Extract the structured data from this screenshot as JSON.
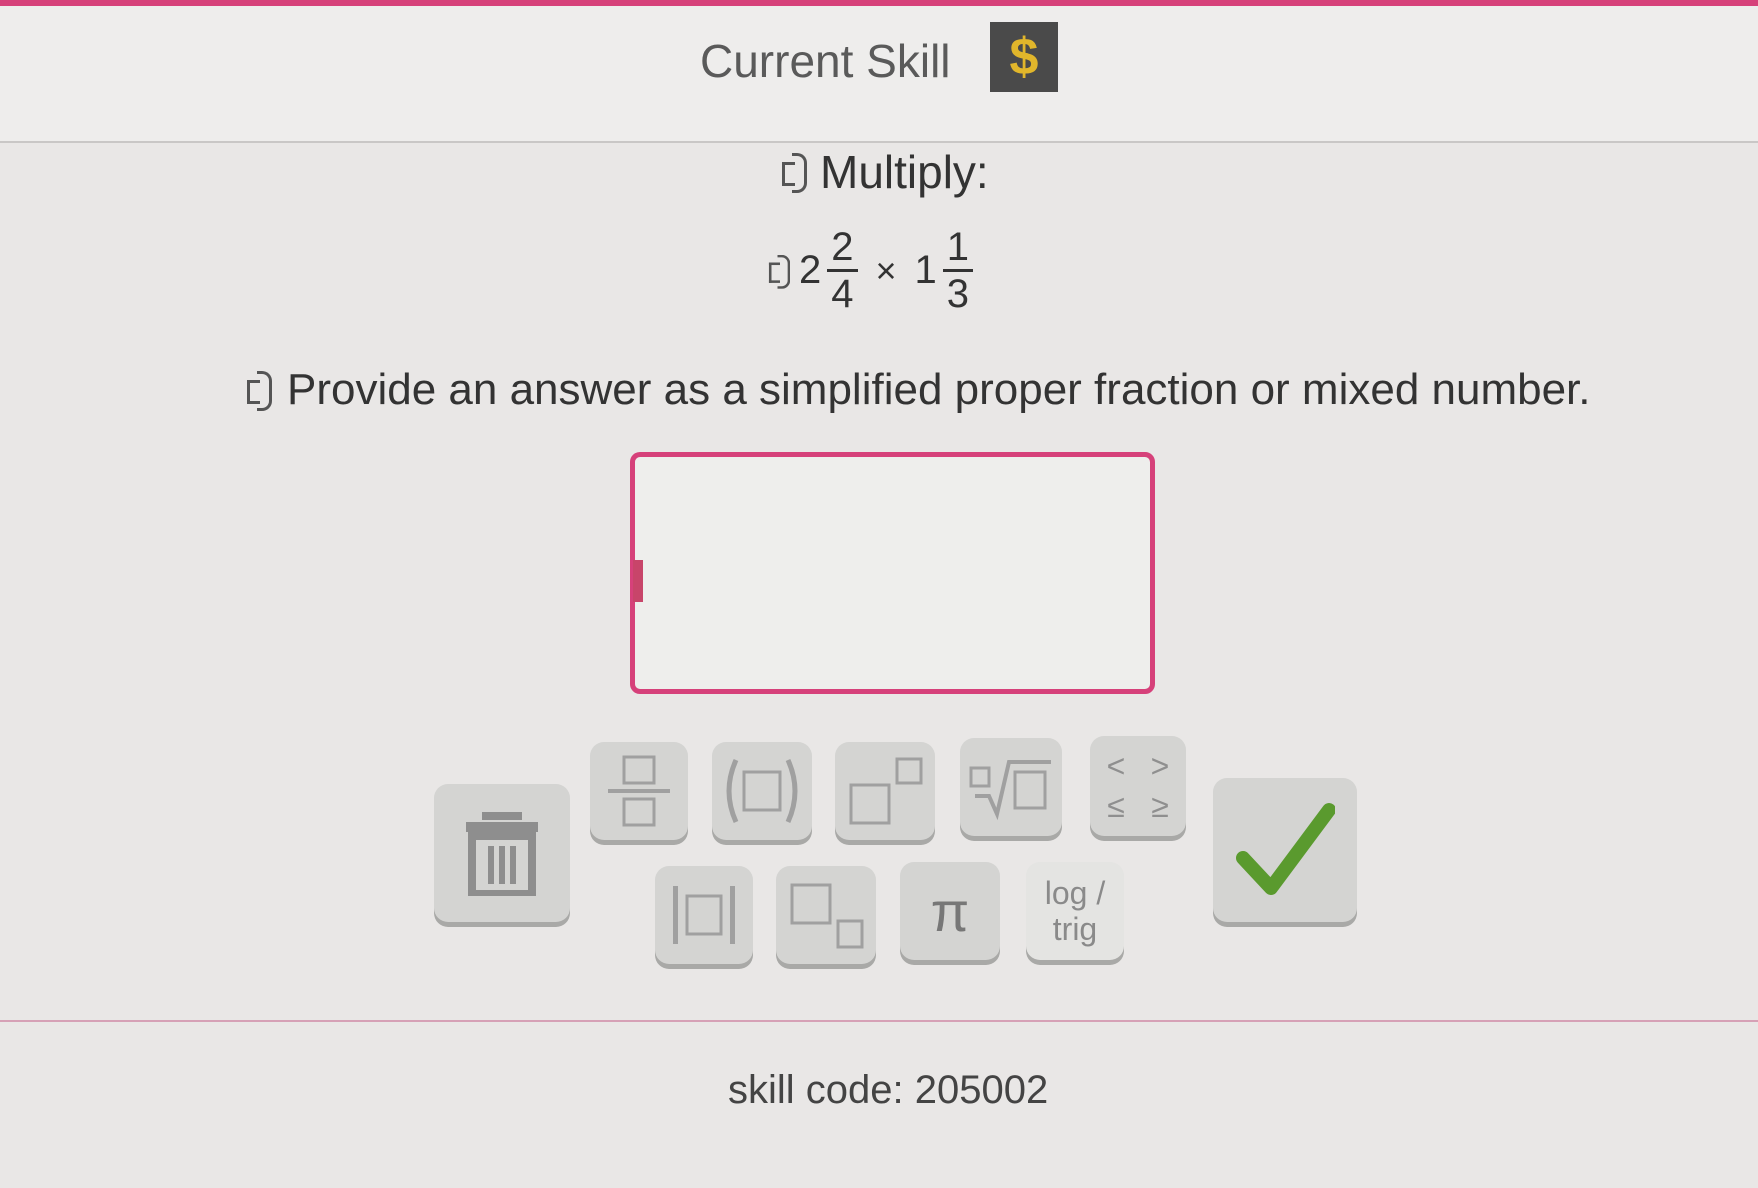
{
  "header": {
    "title": "Current Skill",
    "badge": "$"
  },
  "question": {
    "prompt": "Multiply:",
    "expression": {
      "left": {
        "whole": "2",
        "numerator": "2",
        "denominator": "4"
      },
      "operator": "×",
      "right": {
        "whole": "1",
        "numerator": "1",
        "denominator": "3"
      }
    },
    "instruction": "Provide an answer as a simplified proper fraction or mixed number."
  },
  "answer": {
    "value": ""
  },
  "keypad": {
    "comparison": {
      "lt": "<",
      "gt": ">",
      "le": "≤",
      "ge": "≥"
    },
    "pi": "π",
    "log_trig": {
      "line1": "log /",
      "line2": "trig"
    }
  },
  "footer": {
    "skill_code": "skill code: 205002"
  },
  "colors": {
    "accent": "#d6417a",
    "check": "#5a9a2e",
    "badge_bg": "#4a4a4a",
    "badge_fg": "#e1b62b"
  },
  "icons": [
    "speaker-icon",
    "trash-icon",
    "fraction-icon",
    "parentheses-icon",
    "exponent-icon",
    "root-icon",
    "absolute-value-icon",
    "subscript-icon",
    "checkmark-icon"
  ]
}
